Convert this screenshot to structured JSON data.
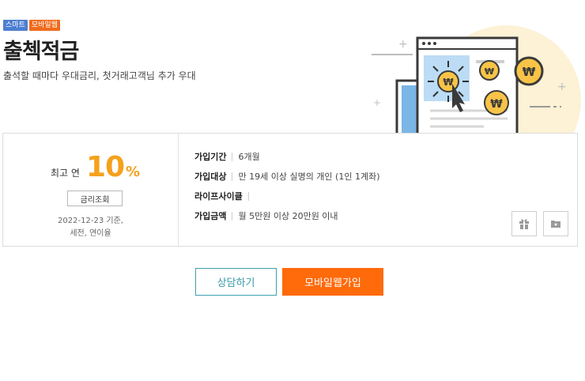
{
  "product": {
    "badges": [
      "스마트",
      "모바일웹"
    ],
    "title": "출첵적금",
    "subtitle": "출석할 때마다 우대금리, 첫거래고객님 추가 우대"
  },
  "rate": {
    "label": "최고 연",
    "value": "10",
    "unit": "%",
    "button": "금리조회",
    "basis_line1": "2022-12-23 기준,",
    "basis_line2": "세전, 연이율"
  },
  "details": [
    {
      "key": "가입기간",
      "value": "6개월"
    },
    {
      "key": "가입대상",
      "value": "만 19세 이상 실명의 개인 (1인 1계좌)"
    },
    {
      "key": "라이프사이클",
      "value": ""
    },
    {
      "key": "가입금액",
      "value": "월 5만원 이상 20만원 이내"
    }
  ],
  "icons": {
    "gift": "gift-icon",
    "folder": "folder-add-icon",
    "illustration_symbol": "₩"
  },
  "actions": {
    "consult": "상담하기",
    "join": "모바일웹가입"
  },
  "colors": {
    "rate_accent": "#f5a11c",
    "join_button": "#ff6a0a",
    "consult_border": "#3ea0ad",
    "badge_smart": "#4c7fd1",
    "badge_mobile": "#ef6b1c"
  }
}
